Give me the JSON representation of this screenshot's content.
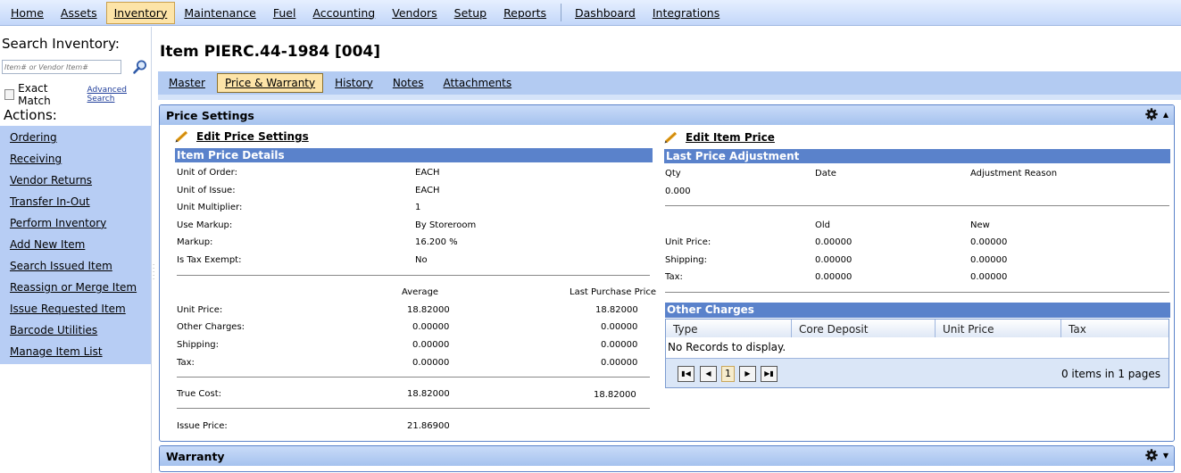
{
  "nav": {
    "items": [
      "Home",
      "Assets",
      "Inventory",
      "Maintenance",
      "Fuel",
      "Accounting",
      "Vendors",
      "Setup",
      "Reports"
    ],
    "items_right": [
      "Dashboard",
      "Integrations"
    ]
  },
  "sidebar": {
    "search_heading": "Search Inventory:",
    "search_placeholder": "Item# or Vendor Item#",
    "exact_match_label": "Exact Match",
    "advanced_search": "Advanced Search",
    "actions_heading": "Actions:",
    "actions": [
      "Ordering",
      "Receiving",
      "Vendor Returns",
      "Transfer In-Out",
      "Perform Inventory",
      "Add New Item",
      "Search Issued Item",
      "Reassign or Merge Item",
      "Issue Requested Item",
      "Barcode Utilities",
      "Manage Item List"
    ]
  },
  "page": {
    "title": "Item PIERC.44-1984 [004]",
    "tabs": [
      "Master",
      "Price & Warranty",
      "History",
      "Notes",
      "Attachments"
    ],
    "active_tab": "Price & Warranty"
  },
  "price": {
    "panel_title": "Price Settings",
    "edit_price_settings": "Edit Price Settings",
    "details_header": "Item Price Details",
    "unit_of_order_label": "Unit of Order:",
    "unit_of_order": "EACH",
    "unit_of_issue_label": "Unit of Issue:",
    "unit_of_issue": "EACH",
    "unit_multiplier_label": "Unit Multiplier:",
    "unit_multiplier": "1",
    "use_markup_label": "Use Markup:",
    "use_markup": "By Storeroom",
    "markup_label": "Markup:",
    "markup": "16.200 %",
    "tax_exempt_label": "Is Tax Exempt:",
    "tax_exempt": "No",
    "col_average": "Average",
    "col_last_purchase": "Last Purchase Price",
    "unit_price_label": "Unit Price:",
    "unit_price_avg": "18.82000",
    "unit_price_last": "18.82000",
    "other_charges_label": "Other Charges:",
    "other_charges_avg": "0.00000",
    "other_charges_last": "0.00000",
    "shipping_label": "Shipping:",
    "shipping_avg": "0.00000",
    "shipping_last": "0.00000",
    "tax_label": "Tax:",
    "tax_avg": "0.00000",
    "tax_last": "0.00000",
    "true_cost_label": "True Cost:",
    "true_cost_avg": "18.82000",
    "true_cost_last": "18.82000",
    "issue_price_label": "Issue Price:",
    "issue_price": "21.86900"
  },
  "adjust": {
    "edit_item_price": "Edit Item Price",
    "header": "Last Price Adjustment",
    "qty_label": "Qty",
    "date_label": "Date",
    "reason_label": "Adjustment Reason",
    "qty": "0.000",
    "old_label": "Old",
    "new_label": "New",
    "unit_price_label": "Unit Price:",
    "unit_price_old": "0.00000",
    "unit_price_new": "0.00000",
    "shipping_label": "Shipping:",
    "shipping_old": "0.00000",
    "shipping_new": "0.00000",
    "tax_label": "Tax:",
    "tax_old": "0.00000",
    "tax_new": "0.00000"
  },
  "other_charges": {
    "header": "Other Charges",
    "columns": [
      "Type",
      "Core Deposit",
      "Unit Price",
      "Tax"
    ],
    "empty": "No Records to display.",
    "current_page": "1",
    "summary": "0 items in 1 pages"
  },
  "warranty": {
    "panel_title": "Warranty"
  }
}
